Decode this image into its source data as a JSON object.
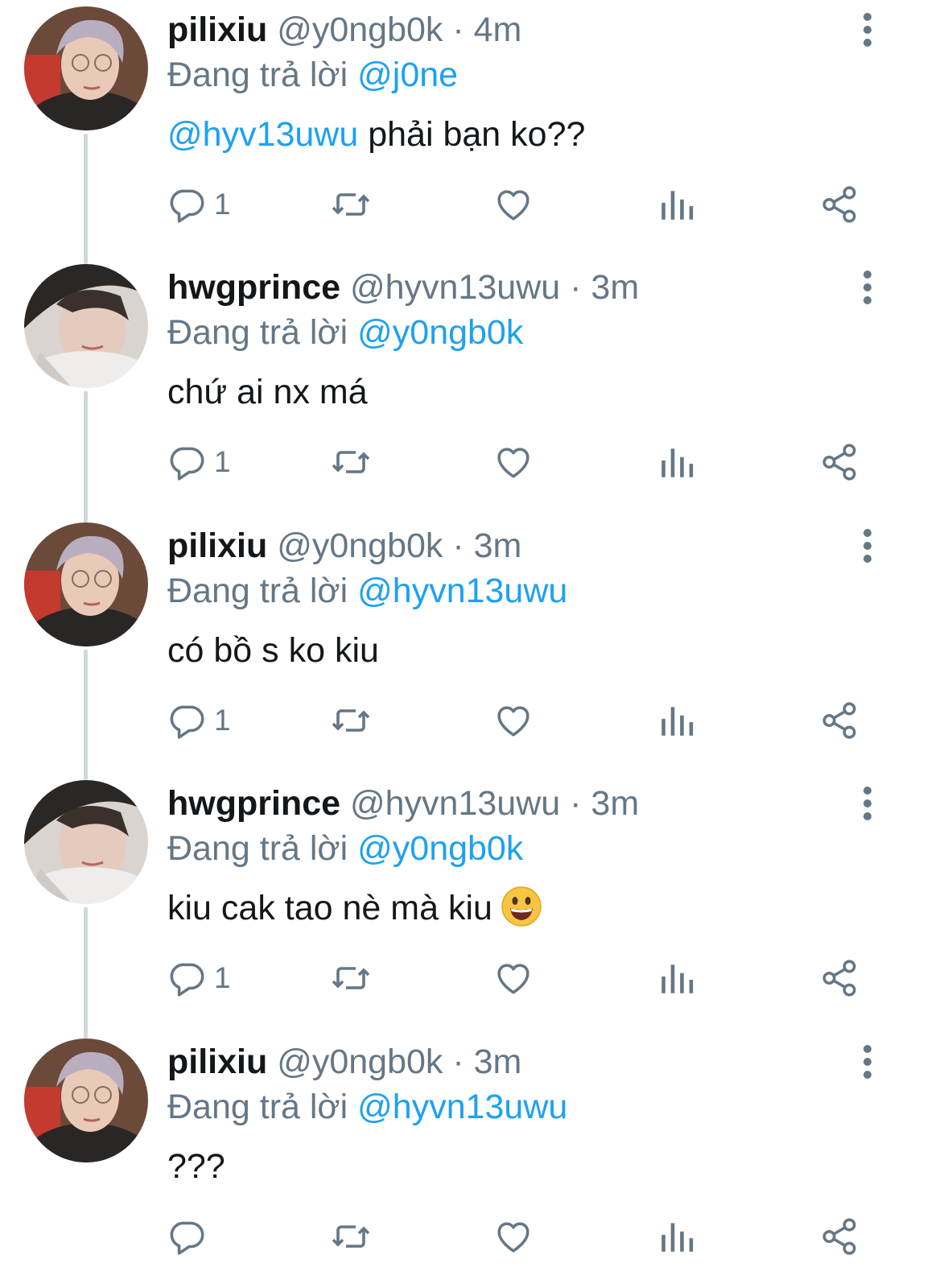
{
  "colors": {
    "name": "#14171a",
    "meta": "#657786",
    "mention": "#1da1f2",
    "thread_line": "#cfd9de",
    "icon": "#657786"
  },
  "icons": {
    "reply": "speech-bubble-icon",
    "retweet": "retweet-arrows-icon",
    "like": "heart-outline-icon",
    "stats": "bar-chart-icon",
    "share": "share-nodes-icon",
    "more": "vertical-ellipsis-icon"
  },
  "tweets": [
    {
      "name": "pilixiu",
      "handle": "@y0ngb0k",
      "sep": " · ",
      "time": "4m",
      "reply_prefix": "Đang trả lời ",
      "reply_to": "@j0ne",
      "body_mention": "@hyv13uwu",
      "body_text": " phải bạn ko??",
      "reply_count": "1"
    },
    {
      "name": "hwgprince",
      "handle": "@hyvn13uwu",
      "sep": " · ",
      "time": "3m",
      "reply_prefix": "Đang trả lời ",
      "reply_to": "@y0ngb0k",
      "body_mention": "",
      "body_text": "chứ ai nx má",
      "reply_count": "1"
    },
    {
      "name": "pilixiu",
      "handle": "@y0ngb0k",
      "sep": " · ",
      "time": "3m",
      "reply_prefix": "Đang trả lời ",
      "reply_to": "@hyvn13uwu",
      "body_mention": "",
      "body_text": "có bồ s ko kiu",
      "reply_count": "1"
    },
    {
      "name": "hwgprince",
      "handle": "@hyvn13uwu",
      "sep": " · ",
      "time": "3m",
      "reply_prefix": "Đang trả lời ",
      "reply_to": "@y0ngb0k",
      "body_mention": "",
      "body_text": "kiu cak tao nè mà kiu",
      "body_emoji": "grinning-face-emoji",
      "reply_count": "1"
    },
    {
      "name": "pilixiu",
      "handle": "@y0ngb0k",
      "sep": " · ",
      "time": "3m",
      "reply_prefix": "Đang trả lời ",
      "reply_to": "@hyvn13uwu",
      "body_mention": "",
      "body_text": "???",
      "reply_count": ""
    }
  ]
}
